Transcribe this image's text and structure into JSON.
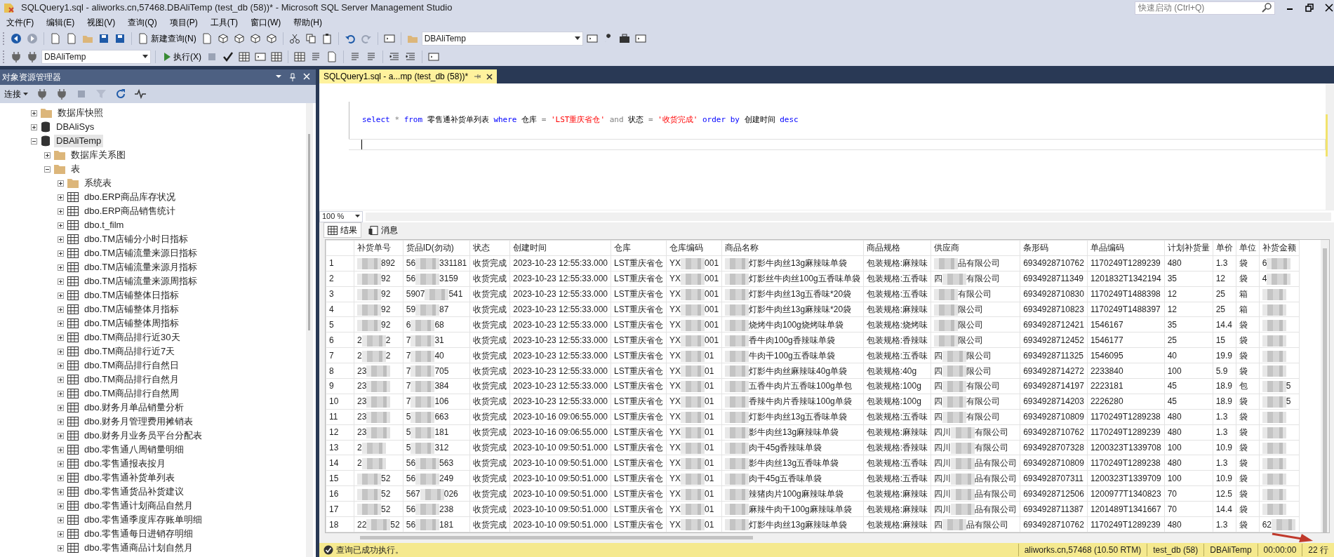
{
  "window": {
    "title": "SQLQuery1.sql - aliworks.cn,57468.DBAliTemp (test_db (58))* - Microsoft SQL Server Management Studio",
    "quick_launch": {
      "placeholder": "快速启动 (Ctrl+Q)"
    }
  },
  "menu": [
    "文件(F)",
    "编辑(E)",
    "视图(V)",
    "查询(Q)",
    "项目(P)",
    "工具(T)",
    "窗口(W)",
    "帮助(H)"
  ],
  "toolbar": {
    "new_query": "新建查询(N)",
    "database": "DBAliTemp"
  },
  "toolbar2": {
    "database": "DBAliTemp",
    "execute": "执行(X)"
  },
  "object_explorer": {
    "title": "对象资源管理器",
    "connect": "连接",
    "tree": [
      {
        "label": "数据库快照",
        "kind": "folder",
        "expanded": false,
        "selected": false
      },
      {
        "label": "DBAliSys",
        "kind": "database",
        "expanded": false,
        "selected": false
      },
      {
        "label": "DBAliTemp",
        "kind": "database",
        "expanded": true,
        "selected": true,
        "children": [
          {
            "label": "数据库关系图",
            "kind": "folder",
            "expanded": false,
            "selected": false
          },
          {
            "label": "表",
            "kind": "folder",
            "expanded": true,
            "selected": false,
            "children": [
              {
                "label": "系统表",
                "kind": "folder",
                "expanded": false,
                "selected": false
              },
              {
                "label": "dbo.ERP商品库存状况",
                "kind": "table",
                "expanded": false,
                "selected": false
              },
              {
                "label": "dbo.ERP商品销售统计",
                "kind": "table",
                "expanded": false,
                "selected": false
              },
              {
                "label": "dbo.t_film",
                "kind": "table",
                "expanded": false,
                "selected": false
              },
              {
                "label": "dbo.TM店铺分小时日指标",
                "kind": "table",
                "expanded": false,
                "selected": false
              },
              {
                "label": "dbo.TM店铺流量来源日指标",
                "kind": "table",
                "expanded": false,
                "selected": false
              },
              {
                "label": "dbo.TM店铺流量来源月指标",
                "kind": "table",
                "expanded": false,
                "selected": false
              },
              {
                "label": "dbo.TM店铺流量来源周指标",
                "kind": "table",
                "expanded": false,
                "selected": false
              },
              {
                "label": "dbo.TM店铺整体日指标",
                "kind": "table",
                "expanded": false,
                "selected": false
              },
              {
                "label": "dbo.TM店铺整体月指标",
                "kind": "table",
                "expanded": false,
                "selected": false
              },
              {
                "label": "dbo.TM店铺整体周指标",
                "kind": "table",
                "expanded": false,
                "selected": false
              },
              {
                "label": "dbo.TM商品排行近30天",
                "kind": "table",
                "expanded": false,
                "selected": false
              },
              {
                "label": "dbo.TM商品排行近7天",
                "kind": "table",
                "expanded": false,
                "selected": false
              },
              {
                "label": "dbo.TM商品排行自然日",
                "kind": "table",
                "expanded": false,
                "selected": false
              },
              {
                "label": "dbo.TM商品排行自然月",
                "kind": "table",
                "expanded": false,
                "selected": false
              },
              {
                "label": "dbo.TM商品排行自然周",
                "kind": "table",
                "expanded": false,
                "selected": false
              },
              {
                "label": "dbo.财务月单品销量分析",
                "kind": "table",
                "expanded": false,
                "selected": false
              },
              {
                "label": "dbo.财务月管理费用摊销表",
                "kind": "table",
                "expanded": false,
                "selected": false
              },
              {
                "label": "dbo.财务月业务员平台分配表",
                "kind": "table",
                "expanded": false,
                "selected": false
              },
              {
                "label": "dbo.零售通八周销量明细",
                "kind": "table",
                "expanded": false,
                "selected": false
              },
              {
                "label": "dbo.零售通报表按月",
                "kind": "table",
                "expanded": false,
                "selected": false
              },
              {
                "label": "dbo.零售通补货单列表",
                "kind": "table",
                "expanded": false,
                "selected": false
              },
              {
                "label": "dbo.零售通货品补货建议",
                "kind": "table",
                "expanded": false,
                "selected": false
              },
              {
                "label": "dbo.零售通计划商品自然月",
                "kind": "table",
                "expanded": false,
                "selected": false
              },
              {
                "label": "dbo.零售通季度库存账单明细",
                "kind": "table",
                "expanded": false,
                "selected": false
              },
              {
                "label": "dbo.零售通每日进销存明细",
                "kind": "table",
                "expanded": false,
                "selected": false
              },
              {
                "label": "dbo.零售通商品计划自然月",
                "kind": "table",
                "expanded": false,
                "selected": false
              }
            ]
          }
        ]
      }
    ]
  },
  "document_tabs": [
    {
      "label": "SQLQuery1.sql - a...mp (test_db (58))*",
      "selected": true
    }
  ],
  "editor": {
    "tokens": [
      {
        "kind": "keyword",
        "text": "select"
      },
      {
        "kind": "operator",
        "text": "*"
      },
      {
        "kind": "keyword",
        "text": "from"
      },
      {
        "kind": "plain",
        "text": "零售通补货单列表"
      },
      {
        "kind": "keyword",
        "text": "where"
      },
      {
        "kind": "plain",
        "text": "仓库"
      },
      {
        "kind": "operator",
        "text": "="
      },
      {
        "kind": "string",
        "text": "'LST重庆省仓'"
      },
      {
        "kind": "operator",
        "text": "and"
      },
      {
        "kind": "plain",
        "text": "状态"
      },
      {
        "kind": "operator",
        "text": "="
      },
      {
        "kind": "string",
        "text": "'收货完成'"
      },
      {
        "kind": "keyword",
        "text": "order by"
      },
      {
        "kind": "plain",
        "text": "创建时间"
      },
      {
        "kind": "keyword",
        "text": "desc"
      }
    ]
  },
  "zoom": "100 %",
  "result_tabs": [
    {
      "label": "结果",
      "selected": true
    },
    {
      "label": "消息",
      "selected": false
    }
  ],
  "grid": {
    "columns": [
      "",
      "补货单号",
      "货品ID(勿动)",
      "状态",
      "创建时间",
      "仓库",
      "仓库编码",
      "商品名称",
      "商品规格",
      "供应商",
      "条形码",
      "单品编码",
      "计划补货量",
      "单价",
      "单位",
      "补货金额"
    ],
    "rows": [
      [
        "1",
        {
          "kind": "blurred",
          "after": "892"
        },
        {
          "kind": "blurred",
          "before": "56",
          "after": "331181"
        },
        "收货完成",
        "2023-10-23 12:55:33.000",
        "LST重庆省仓",
        {
          "kind": "blurred",
          "before": "YX",
          "after": "001"
        },
        {
          "kind": "blurred",
          "after": "灯影牛肉丝13g麻辣味单袋"
        },
        "包装规格:麻辣味",
        {
          "kind": "blurred",
          "after": "品有限公司"
        },
        "6934928710762",
        "1170249T1289239",
        "480",
        "1.3",
        "袋",
        {
          "kind": "blurred",
          "before": "6"
        }
      ],
      [
        "2",
        {
          "kind": "blurred",
          "after": "92"
        },
        {
          "kind": "blurred",
          "before": "56",
          "after": "3159"
        },
        "收货完成",
        "2023-10-23 12:55:33.000",
        "LST重庆省仓",
        {
          "kind": "blurred",
          "before": "YX",
          "after": "001"
        },
        {
          "kind": "blurred",
          "after": "灯影丝牛肉丝100g五香味单袋"
        },
        "包装规格:五香味",
        {
          "kind": "blurred",
          "before": "四",
          "after": "有限公司"
        },
        "6934928711349",
        "1201832T1342194",
        "35",
        "12",
        "袋",
        {
          "kind": "blurred",
          "before": "4"
        }
      ],
      [
        "3",
        {
          "kind": "blurred",
          "after": "92"
        },
        {
          "kind": "blurred",
          "before": "5907",
          "after": "541"
        },
        "收货完成",
        "2023-10-23 12:55:33.000",
        "LST重庆省仓",
        {
          "kind": "blurred",
          "before": "YX",
          "after": "001"
        },
        {
          "kind": "blurred",
          "after": "灯影牛肉丝13g五香味*20袋"
        },
        "包装规格:五香味",
        {
          "kind": "blurred",
          "after": "有限公司"
        },
        "6934928710830",
        "1170249T1488398",
        "12",
        "25",
        "箱",
        {
          "kind": "blurred"
        }
      ],
      [
        "4",
        {
          "kind": "blurred",
          "after": "92"
        },
        {
          "kind": "blurred",
          "before": "59",
          "after": "87"
        },
        "收货完成",
        "2023-10-23 12:55:33.000",
        "LST重庆省仓",
        {
          "kind": "blurred",
          "before": "YX",
          "after": "001"
        },
        {
          "kind": "blurred",
          "after": "灯影牛肉丝13g麻辣味*20袋"
        },
        "包装规格:麻辣味",
        {
          "kind": "blurred",
          "after": "限公司"
        },
        "6934928710823",
        "1170249T1488397",
        "12",
        "25",
        "箱",
        {
          "kind": "blurred"
        }
      ],
      [
        "5",
        {
          "kind": "blurred",
          "after": "92"
        },
        {
          "kind": "blurred",
          "before": "6",
          "after": "68"
        },
        "收货完成",
        "2023-10-23 12:55:33.000",
        "LST重庆省仓",
        {
          "kind": "blurred",
          "before": "YX",
          "after": "001"
        },
        {
          "kind": "blurred",
          "after": "烧烤牛肉100g烧烤味单袋"
        },
        "包装规格:烧烤味",
        {
          "kind": "blurred",
          "after": "限公司"
        },
        "6934928712421",
        "1546167",
        "35",
        "14.4",
        "袋",
        {
          "kind": "blurred"
        }
      ],
      [
        "6",
        {
          "kind": "blurred",
          "before": "2",
          "after": "2"
        },
        {
          "kind": "blurred",
          "before": "7",
          "after": "31"
        },
        "收货完成",
        "2023-10-23 12:55:33.000",
        "LST重庆省仓",
        {
          "kind": "blurred",
          "before": "YX",
          "after": "001"
        },
        {
          "kind": "blurred",
          "after": "香牛肉100g香辣味单袋"
        },
        "包装规格:香辣味",
        {
          "kind": "blurred",
          "after": "限公司"
        },
        "6934928712452",
        "1546177",
        "25",
        "15",
        "袋",
        {
          "kind": "blurred"
        }
      ],
      [
        "7",
        {
          "kind": "blurred",
          "before": "2",
          "after": "2"
        },
        {
          "kind": "blurred",
          "before": "7",
          "after": "40"
        },
        "收货完成",
        "2023-10-23 12:55:33.000",
        "LST重庆省仓",
        {
          "kind": "blurred",
          "before": "YX",
          "after": "01"
        },
        {
          "kind": "blurred",
          "after": "牛肉干100g五香味单袋"
        },
        "包装规格:五香味",
        {
          "kind": "blurred",
          "before": "四",
          "after": "限公司"
        },
        "6934928711325",
        "1546095",
        "40",
        "19.9",
        "袋",
        {
          "kind": "blurred"
        }
      ],
      [
        "8",
        {
          "kind": "blurred",
          "before": "23"
        },
        {
          "kind": "blurred",
          "before": "7",
          "after": "705"
        },
        "收货完成",
        "2023-10-23 12:55:33.000",
        "LST重庆省仓",
        {
          "kind": "blurred",
          "before": "YX",
          "after": "01"
        },
        {
          "kind": "blurred",
          "after": "灯影牛肉丝麻辣味40g单袋"
        },
        "包装规格:40g",
        {
          "kind": "blurred",
          "before": "四",
          "after": "限公司"
        },
        "6934928714272",
        "2233840",
        "100",
        "5.9",
        "袋",
        {
          "kind": "blurred"
        }
      ],
      [
        "9",
        {
          "kind": "blurred",
          "before": "23"
        },
        {
          "kind": "blurred",
          "before": "7",
          "after": "384"
        },
        "收货完成",
        "2023-10-23 12:55:33.000",
        "LST重庆省仓",
        {
          "kind": "blurred",
          "before": "YX",
          "after": "01"
        },
        {
          "kind": "blurred",
          "after": "五香牛肉片五香味100g单包"
        },
        "包装规格:100g",
        {
          "kind": "blurred",
          "before": "四",
          "after": "有限公司"
        },
        "6934928714197",
        "2223181",
        "45",
        "18.9",
        "包",
        {
          "kind": "blurred",
          "after": "5"
        }
      ],
      [
        "10",
        {
          "kind": "blurred",
          "before": "23"
        },
        {
          "kind": "blurred",
          "before": "7",
          "after": "106"
        },
        "收货完成",
        "2023-10-23 12:55:33.000",
        "LST重庆省仓",
        {
          "kind": "blurred",
          "before": "YX",
          "after": "01"
        },
        {
          "kind": "blurred",
          "after": "香辣牛肉片香辣味100g单袋"
        },
        "包装规格:100g",
        {
          "kind": "blurred",
          "before": "四",
          "after": "有限公司"
        },
        "6934928714203",
        "2226280",
        "45",
        "18.9",
        "袋",
        {
          "kind": "blurred",
          "after": "5"
        }
      ],
      [
        "11",
        {
          "kind": "blurred",
          "before": "23"
        },
        {
          "kind": "blurred",
          "before": "5",
          "after": "663"
        },
        "收货完成",
        "2023-10-16 09:06:55.000",
        "LST重庆省仓",
        {
          "kind": "blurred",
          "before": "YX",
          "after": "01"
        },
        {
          "kind": "blurred",
          "after": "灯影牛肉丝13g五香味单袋"
        },
        "包装规格:五香味",
        {
          "kind": "blurred",
          "before": "四",
          "after": "有限公司"
        },
        "6934928710809",
        "1170249T1289238",
        "480",
        "1.3",
        "袋",
        {
          "kind": "blurred"
        }
      ],
      [
        "12",
        {
          "kind": "blurred",
          "before": "23"
        },
        {
          "kind": "blurred",
          "before": "5",
          "after": "181"
        },
        "收货完成",
        "2023-10-16 09:06:55.000",
        "LST重庆省仓",
        {
          "kind": "blurred",
          "before": "YX",
          "after": "01"
        },
        {
          "kind": "blurred",
          "after": "影牛肉丝13g麻辣味单袋"
        },
        "包装规格:麻辣味",
        {
          "kind": "blurred",
          "before": "四川",
          "after": "有限公司"
        },
        "6934928710762",
        "1170249T1289239",
        "480",
        "1.3",
        "袋",
        {
          "kind": "blurred"
        }
      ],
      [
        "13",
        {
          "kind": "blurred",
          "before": "2"
        },
        {
          "kind": "blurred",
          "before": "5",
          "after": "312"
        },
        "收货完成",
        "2023-10-10 09:50:51.000",
        "LST重庆省仓",
        {
          "kind": "blurred",
          "before": "YX",
          "after": "01"
        },
        {
          "kind": "blurred",
          "after": "肉干45g香辣味单袋"
        },
        "包装规格:香辣味",
        {
          "kind": "blurred",
          "before": "四川",
          "after": "有限公司"
        },
        "6934928707328",
        "1200323T1339708",
        "100",
        "10.9",
        "袋",
        {
          "kind": "blurred"
        }
      ],
      [
        "14",
        {
          "kind": "blurred",
          "before": "2"
        },
        {
          "kind": "blurred",
          "before": "56",
          "after": "563"
        },
        "收货完成",
        "2023-10-10 09:50:51.000",
        "LST重庆省仓",
        {
          "kind": "blurred",
          "before": "YX",
          "after": "01"
        },
        {
          "kind": "blurred",
          "after": "影牛肉丝13g五香味单袋"
        },
        "包装规格:五香味",
        {
          "kind": "blurred",
          "before": "四川",
          "after": "品有限公司"
        },
        "6934928710809",
        "1170249T1289238",
        "480",
        "1.3",
        "袋",
        {
          "kind": "blurred"
        }
      ],
      [
        "15",
        {
          "kind": "blurred",
          "after": "52"
        },
        {
          "kind": "blurred",
          "before": "56",
          "after": "249"
        },
        "收货完成",
        "2023-10-10 09:50:51.000",
        "LST重庆省仓",
        {
          "kind": "blurred",
          "before": "YX",
          "after": "01"
        },
        {
          "kind": "blurred",
          "after": "肉干45g五香味单袋"
        },
        "包装规格:五香味",
        {
          "kind": "blurred",
          "before": "四川",
          "after": "品有限公司"
        },
        "6934928707311",
        "1200323T1339709",
        "100",
        "10.9",
        "袋",
        {
          "kind": "blurred"
        }
      ],
      [
        "16",
        {
          "kind": "blurred",
          "after": "52"
        },
        {
          "kind": "blurred",
          "before": "567",
          "after": "026"
        },
        "收货完成",
        "2023-10-10 09:50:51.000",
        "LST重庆省仓",
        {
          "kind": "blurred",
          "before": "YX",
          "after": "01"
        },
        {
          "kind": "blurred",
          "after": "辣猪肉片100g麻辣味单袋"
        },
        "包装规格:麻辣味",
        {
          "kind": "blurred",
          "before": "四川",
          "after": "品有限公司"
        },
        "6934928712506",
        "1200977T1340823",
        "70",
        "12.5",
        "袋",
        {
          "kind": "blurred"
        }
      ],
      [
        "17",
        {
          "kind": "blurred",
          "after": "52"
        },
        {
          "kind": "blurred",
          "before": "56",
          "after": "238"
        },
        "收货完成",
        "2023-10-10 09:50:51.000",
        "LST重庆省仓",
        {
          "kind": "blurred",
          "before": "YX",
          "after": "01"
        },
        {
          "kind": "blurred",
          "after": "麻辣牛肉干100g麻辣味单袋"
        },
        "包装规格:麻辣味",
        {
          "kind": "blurred",
          "before": "四川",
          "after": "品有限公司"
        },
        "6934928711387",
        "1201489T1341667",
        "70",
        "14.4",
        "袋",
        {
          "kind": "blurred"
        }
      ],
      [
        "18",
        {
          "kind": "blurred",
          "before": "22",
          "after": "52"
        },
        {
          "kind": "blurred",
          "before": "56",
          "after": "181"
        },
        "收货完成",
        "2023-10-10 09:50:51.000",
        "LST重庆省仓",
        {
          "kind": "blurred",
          "before": "YX",
          "after": "01"
        },
        {
          "kind": "blurred",
          "after": "灯影牛肉丝13g麻辣味单袋"
        },
        "包装规格:麻辣味",
        {
          "kind": "blurred",
          "before": "四",
          "after": "品有限公司"
        },
        "6934928710762",
        "1170249T1289239",
        "480",
        "1.3",
        "袋",
        {
          "kind": "blurred",
          "before": "62"
        }
      ]
    ]
  },
  "status_bar": {
    "message": "查询已成功执行。",
    "segments": [
      "aliworks.cn,57468 (10.50 RTM)",
      "test_db (58)",
      "DBAliTemp",
      "00:00:00",
      "22 行"
    ]
  },
  "annotation": {
    "kind": "arrow"
  }
}
